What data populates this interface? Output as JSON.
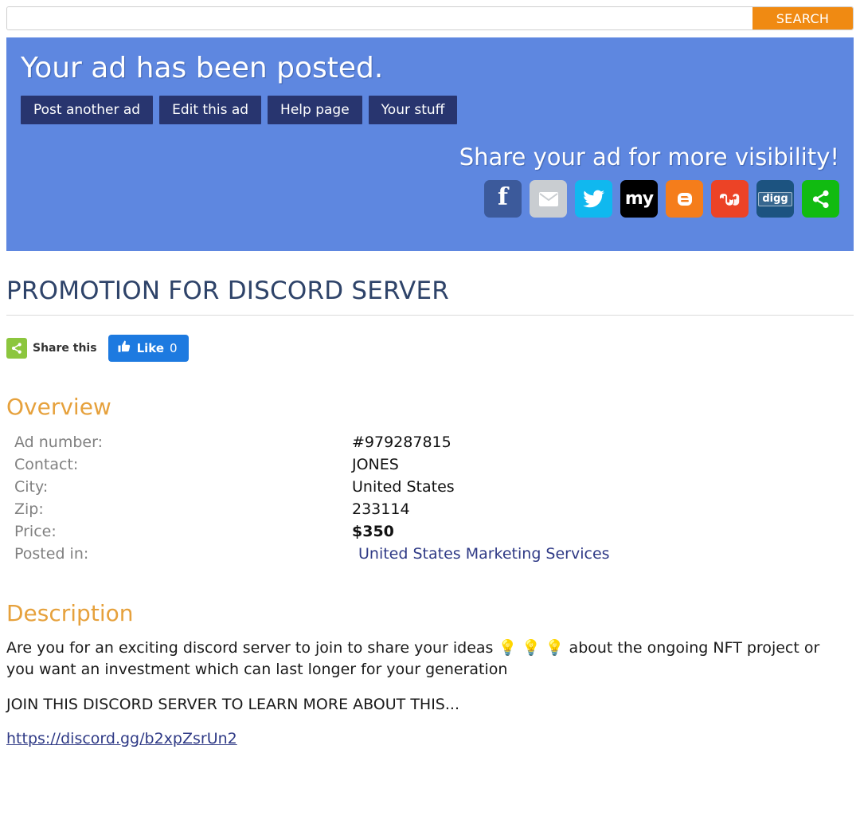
{
  "search": {
    "value": "",
    "placeholder": "",
    "button_label": "SEARCH"
  },
  "notice": {
    "title": "Your ad has been posted.",
    "buttons": [
      {
        "label": "Post another ad"
      },
      {
        "label": "Edit this ad"
      },
      {
        "label": "Help page"
      },
      {
        "label": "Your stuff"
      }
    ],
    "share_heading": "Share your ad for more visibility!",
    "social": [
      {
        "name": "facebook",
        "glyph": "f",
        "color": "#3c5a9b"
      },
      {
        "name": "email",
        "glyph": "",
        "color": "#c9cdd1"
      },
      {
        "name": "twitter",
        "glyph": "",
        "color": "#10b8ef"
      },
      {
        "name": "myspace",
        "glyph": "my",
        "color": "#000000"
      },
      {
        "name": "blogger",
        "glyph": "B",
        "color": "#f57d1b"
      },
      {
        "name": "stumbleupon",
        "glyph": "su",
        "color": "#ec4326"
      },
      {
        "name": "digg",
        "glyph": "digg",
        "color": "#1c5380"
      },
      {
        "name": "share",
        "glyph": "",
        "color": "#11bb11"
      }
    ]
  },
  "ad": {
    "title": "PROMOTION FOR DISCORD SERVER",
    "share_this_label": "Share this",
    "like_label": "Like",
    "like_count": "0"
  },
  "overview": {
    "heading": "Overview",
    "rows": [
      {
        "label": "Ad number:",
        "value": "#979287815",
        "bold": false,
        "link": false
      },
      {
        "label": "Contact:",
        "value": "JONES",
        "bold": false,
        "link": false
      },
      {
        "label": "City:",
        "value": "United States",
        "bold": false,
        "link": false
      },
      {
        "label": "Zip:",
        "value": "233114",
        "bold": false,
        "link": false
      },
      {
        "label": "Price:",
        "value": "$350",
        "bold": true,
        "link": false
      },
      {
        "label": "Posted in:",
        "value": "United States Marketing Services",
        "bold": false,
        "link": true
      }
    ]
  },
  "description": {
    "heading": "Description",
    "paragraph1": "Are you for an exciting discord server to join to share your ideas 💡 💡 💡 about the ongoing NFT project or you want an investment which can last longer for your generation",
    "paragraph2": "JOIN THIS DISCORD SERVER TO LEARN MORE ABOUT THIS...",
    "link": "https://discord.gg/b2xpZsrUn2"
  },
  "colors": {
    "panel_blue": "#5e87e0",
    "button_navy": "#28356f",
    "accent_orange": "#e6a13c",
    "search_orange": "#f08a12",
    "title_navy": "#2e4369",
    "link_indigo": "#2f3a86"
  }
}
